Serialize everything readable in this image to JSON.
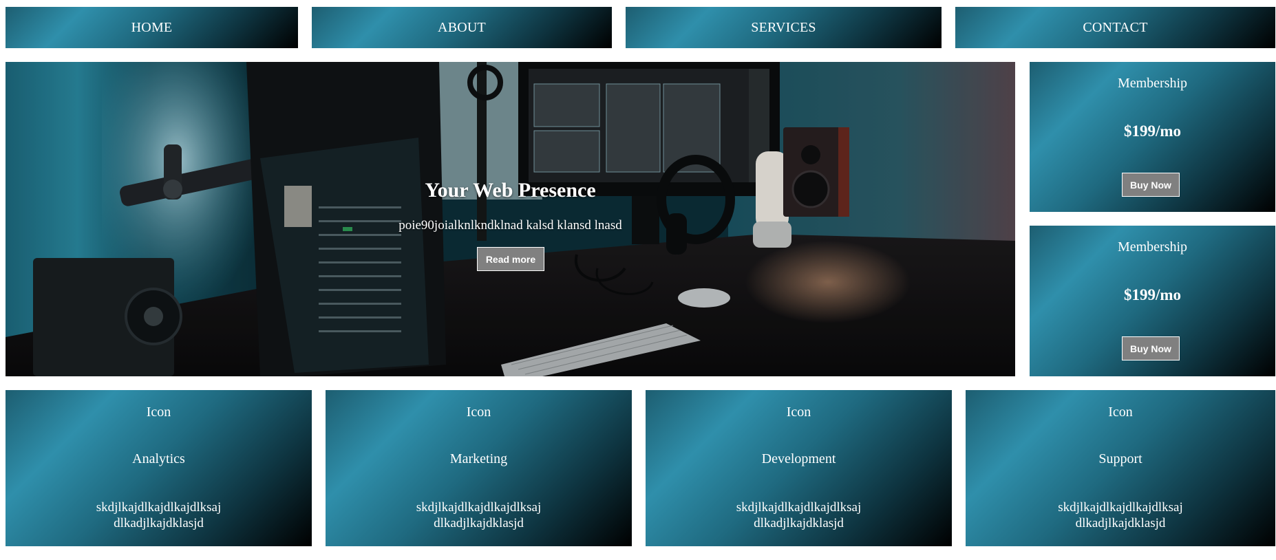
{
  "nav": {
    "items": [
      {
        "label": "HOME"
      },
      {
        "label": "ABOUT"
      },
      {
        "label": "SERVICES"
      },
      {
        "label": "CONTACT"
      }
    ]
  },
  "hero": {
    "title": "Your Web Presence",
    "subtitle": "poie90joialknlkndklnad kalsd klansd lnasd",
    "button_label": "Read more",
    "image_description_icon": "desk-setup-photo"
  },
  "pricing": [
    {
      "name": "Membership",
      "price": "$199/mo",
      "button_label": "Buy Now"
    },
    {
      "name": "Membership",
      "price": "$199/mo",
      "button_label": "Buy Now"
    }
  ],
  "features": [
    {
      "icon": "Icon",
      "title": "Analytics",
      "desc_line1": "skdjlkajdlkajdlkajdlksaj",
      "desc_line2": "dlkadjlkajdklasjd"
    },
    {
      "icon": "Icon",
      "title": "Marketing",
      "desc_line1": "skdjlkajdlkajdlkajdlksaj",
      "desc_line2": "dlkadjlkajdklasjd"
    },
    {
      "icon": "Icon",
      "title": "Development",
      "desc_line1": "skdjlkajdlkajdlkajdlksaj",
      "desc_line2": "dlkadjlkajdklasjd"
    },
    {
      "icon": "Icon",
      "title": "Support",
      "desc_line1": "skdjlkajdlkajdlkajdlksaj",
      "desc_line2": "dlkadjlkajdklasjd"
    }
  ],
  "colors": {
    "gradient_light": "#2f8fab",
    "gradient_dark": "#000000",
    "button_bg": "#808080",
    "button_border": "#ffffff",
    "text": "#ffffff"
  }
}
